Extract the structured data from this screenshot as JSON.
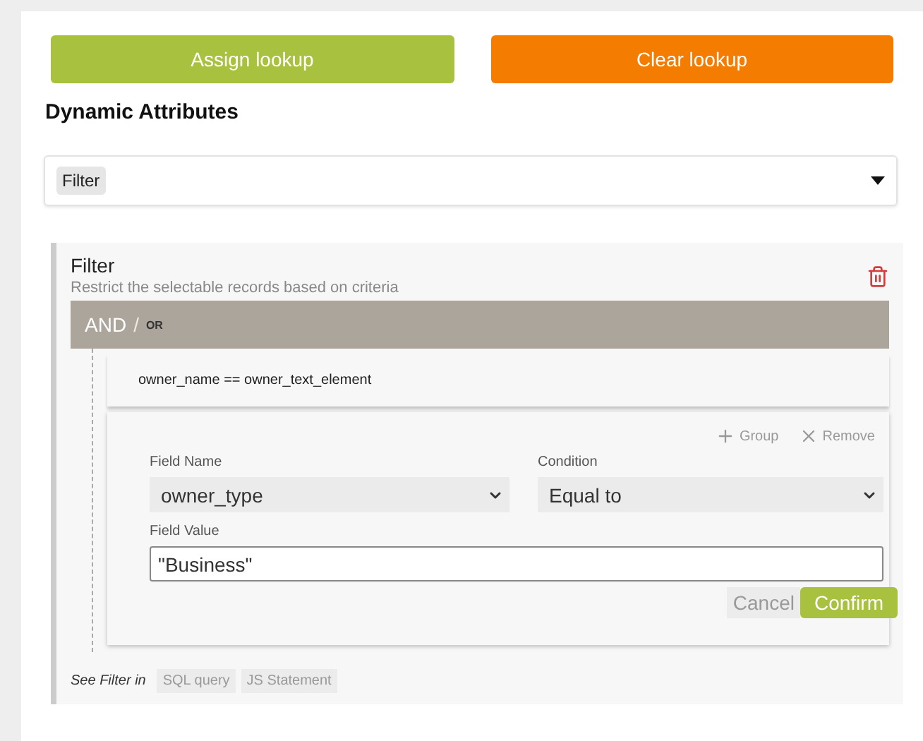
{
  "actions": [
    {
      "label": "Assign lookup",
      "kind": "assign"
    },
    {
      "label": "Clear lookup",
      "kind": "clear"
    }
  ],
  "section_title": "Dynamic Attributes",
  "attribute_select": {
    "tags": [
      "Filter"
    ]
  },
  "filter": {
    "title": "Filter",
    "description": "Restrict the selectable records based on criteria",
    "conjunctions": [
      {
        "label": "AND",
        "selected": true
      },
      {
        "label": "OR",
        "selected": false
      }
    ],
    "separator": "/",
    "rules": [
      {
        "text": "owner_name == owner_text_element"
      }
    ],
    "editor": {
      "group_label": "Group",
      "remove_label": "Remove",
      "field_name": {
        "label": "Field Name",
        "value": "owner_type"
      },
      "condition": {
        "label": "Condition",
        "value": "Equal to"
      },
      "field_value": {
        "label": "Field Value",
        "value": "\"Business\""
      },
      "cancel": "Cancel",
      "confirm": "Confirm"
    },
    "see_in": {
      "label": "See Filter in",
      "links": [
        "SQL query",
        "JS Statement"
      ]
    }
  }
}
